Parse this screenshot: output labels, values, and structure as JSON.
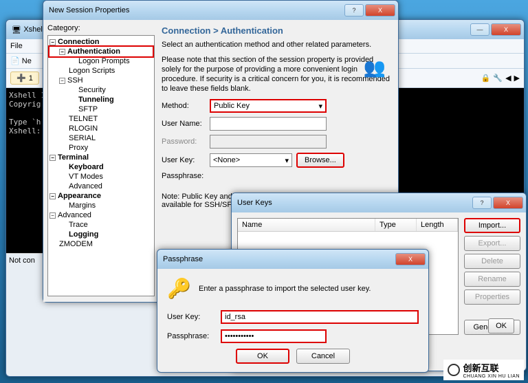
{
  "xshell": {
    "title": "Xshell",
    "file_menu": "File",
    "new_btn": "Ne",
    "tab_label": "1",
    "not_connected": "Not con",
    "terminal_lines": "Xshell 1\nCopyrig\n\nType `h\nXshell:\n"
  },
  "session": {
    "title": "New Session Properties",
    "category_label": "Category:",
    "tree": {
      "connection": "Connection",
      "authentication": "Authentication",
      "logon_prompts": "Logon Prompts",
      "logon_scripts": "Logon Scripts",
      "ssh": "SSH",
      "security": "Security",
      "tunneling": "Tunneling",
      "sftp": "SFTP",
      "telnet": "TELNET",
      "rlogin": "RLOGIN",
      "serial": "SERIAL",
      "proxy": "Proxy",
      "terminal": "Terminal",
      "keyboard": "Keyboard",
      "vt_modes": "VT Modes",
      "advanced": "Advanced",
      "appearance": "Appearance",
      "margins": "Margins",
      "advanced2": "Advanced",
      "trace": "Trace",
      "logging": "Logging",
      "zmodem": "ZMODEM"
    },
    "heading": "Connection > Authentication",
    "desc1": "Select an authentication method and other related parameters.",
    "desc2": "Please note that this section of the session property is provided solely for the purpose of providing a more convenient login procedure. If security is a critical concern for you, it is recommended to leave these fields blank.",
    "method_label": "Method:",
    "method_value": "Public Key",
    "username_label": "User Name:",
    "password_label": "Password:",
    "userkey_label": "User Key:",
    "userkey_value": "<None>",
    "browse_btn": "Browse...",
    "passphrase_label": "Passphrase:",
    "note": "Note: Public Key and\navailable for SSH/SFT"
  },
  "userkeys": {
    "title": "User Keys",
    "col_name": "Name",
    "col_type": "Type",
    "col_length": "Length",
    "import_btn": "Import...",
    "export_btn": "Export...",
    "delete_btn": "Delete",
    "rename_btn": "Rename",
    "properties_btn": "Properties",
    "generate_btn": "Generate...",
    "ok_btn": "OK"
  },
  "passphrase": {
    "title": "Passphrase",
    "prompt": "Enter a passphrase to import the selected user key.",
    "userkey_label": "User Key:",
    "userkey_value": "id_rsa",
    "passphrase_label": "Passphrase:",
    "passphrase_value": "•••••••••••",
    "ok": "OK",
    "cancel": "Cancel"
  },
  "watermark": {
    "brand": "创新互联",
    "domain": "CHUANG XIN HU LIAN"
  }
}
